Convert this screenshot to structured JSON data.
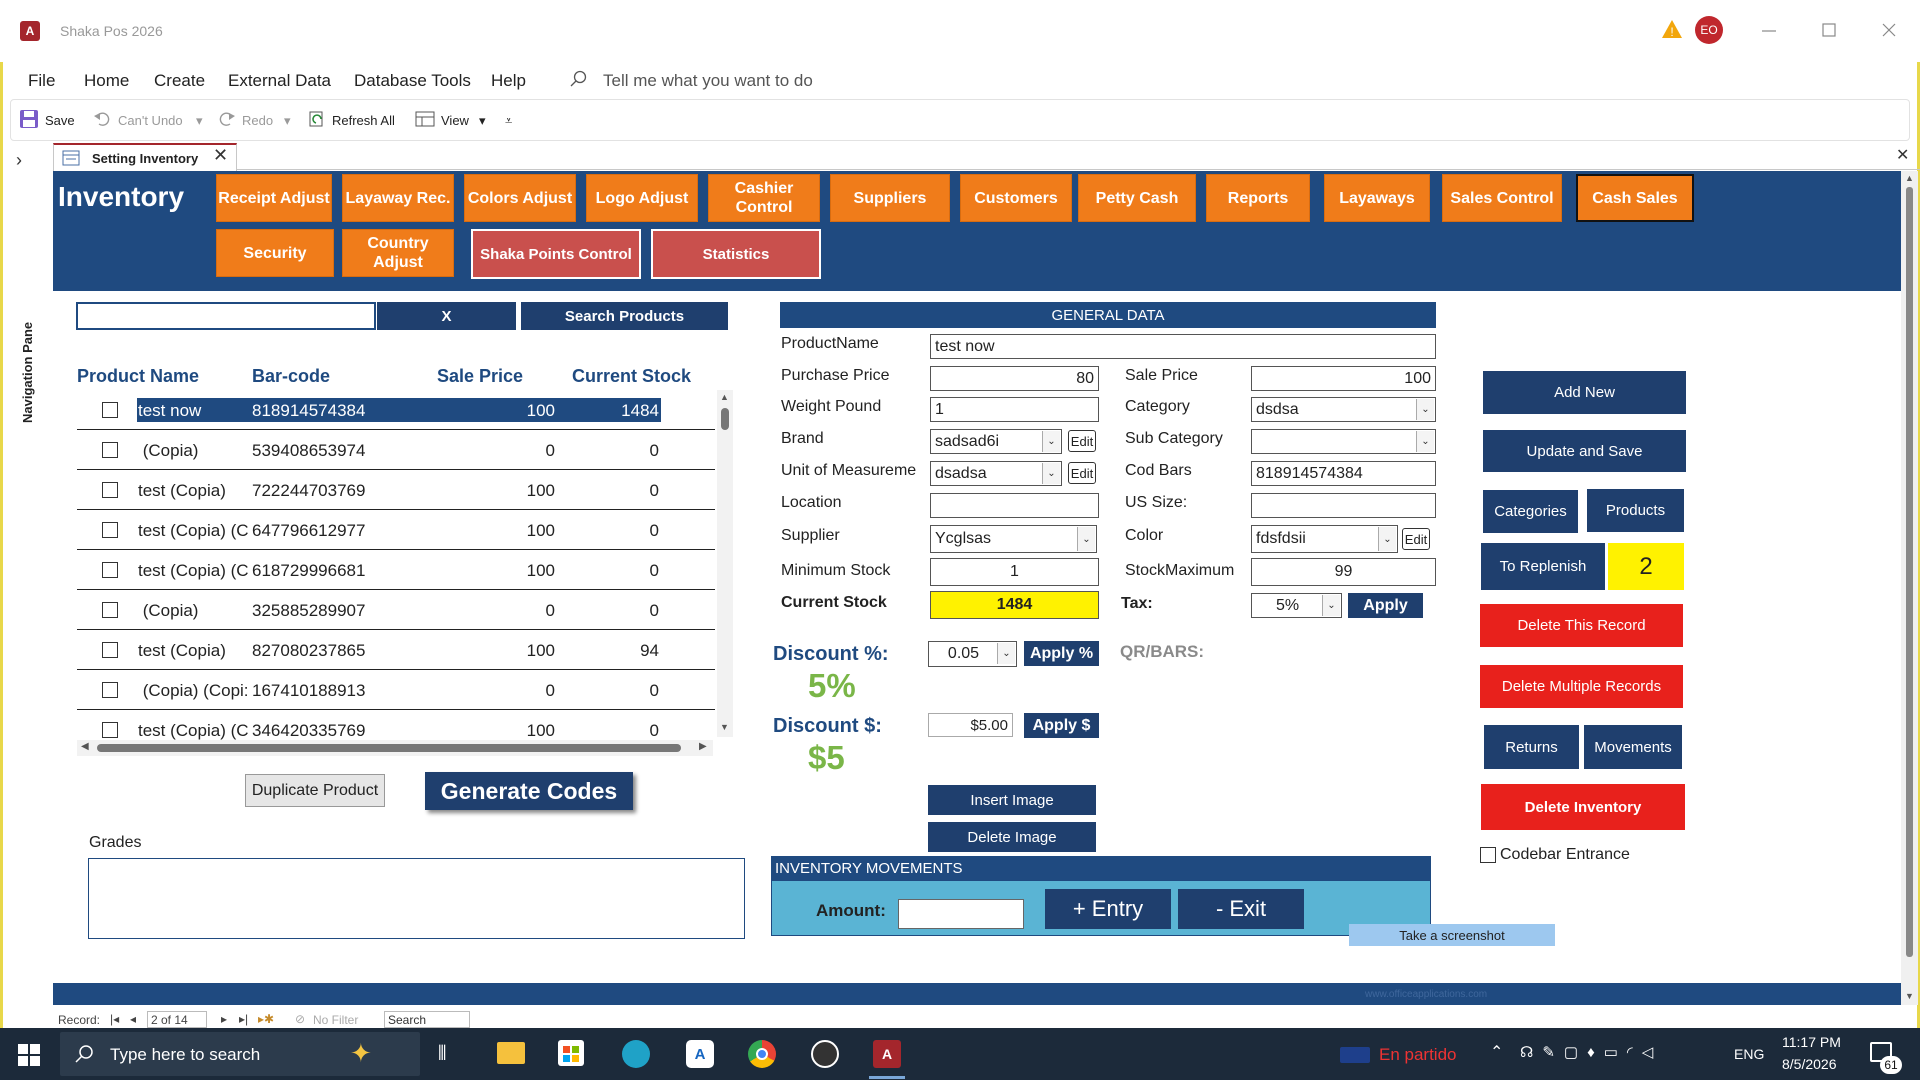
{
  "window": {
    "title": "Shaka Pos 2026",
    "avatar": "EO"
  },
  "menu": {
    "file": "File",
    "home": "Home",
    "create": "Create",
    "external": "External Data",
    "dbtools": "Database Tools",
    "help": "Help",
    "tell": "Tell me what you want to do"
  },
  "qat": {
    "save": "Save",
    "undo": "Can't Undo",
    "redo": "Redo",
    "refresh": "Refresh All",
    "view": "View"
  },
  "nav": {
    "pane": "Navigation Pane"
  },
  "tab": {
    "label": "Setting Inventory"
  },
  "header": {
    "title": "Inventory",
    "row1": [
      "Receipt Adjust",
      "Layaway Rec.",
      "Colors Adjust",
      "Logo Adjust",
      "Cashier Control",
      "Suppliers",
      "Customers",
      "Petty Cash",
      "Reports",
      "Layaways",
      "Sales Control",
      "Cash Sales"
    ],
    "security": "Security",
    "country": "Country Adjust",
    "shaka_points": "Shaka Points Control",
    "statistics": "Statistics"
  },
  "search": {
    "value": "",
    "clear": "X",
    "button": "Search Products"
  },
  "list": {
    "headers": {
      "name": "Product Name",
      "barcode": "Bar-code",
      "price": "Sale Price",
      "stock": "Current Stock"
    },
    "rows": [
      {
        "name": "test now",
        "barcode": "818914574384",
        "price": "100",
        "stock": "1484"
      },
      {
        "name": " (Copia)",
        "barcode": "539408653974",
        "price": "0",
        "stock": "0"
      },
      {
        "name": "test (Copia)",
        "barcode": "722244703769",
        "price": "100",
        "stock": "0"
      },
      {
        "name": "test (Copia) (C",
        "barcode": "647796612977",
        "price": "100",
        "stock": "0"
      },
      {
        "name": "test (Copia) (C",
        "barcode": "618729996681",
        "price": "100",
        "stock": "0"
      },
      {
        "name": " (Copia)",
        "barcode": "325885289907",
        "price": "0",
        "stock": "0"
      },
      {
        "name": "test (Copia)",
        "barcode": "827080237865",
        "price": "100",
        "stock": "94"
      },
      {
        "name": " (Copia) (Copi:",
        "barcode": "167410188913",
        "price": "0",
        "stock": "0"
      },
      {
        "name": "test (Copia) (C",
        "barcode": "346420335769",
        "price": "100",
        "stock": "0"
      }
    ]
  },
  "actions": {
    "duplicate": "Duplicate Product",
    "generate": "Generate Codes",
    "grades": "Grades"
  },
  "general": {
    "title": "GENERAL DATA",
    "product_name_label": "ProductName",
    "product_name": "test now",
    "purchase_label": "Purchase Price",
    "purchase": "80",
    "sale_label": "Sale Price",
    "sale": "100",
    "weight_label": "Weight Pound",
    "weight": "1",
    "category_label": "Category",
    "category": "dsdsa",
    "brand_label": "Brand",
    "brand": "sadsad6i",
    "subcat_label": "Sub Category",
    "subcat": "",
    "unit_label": "Unit of Measureme",
    "unit": "dsadsa",
    "codbars_label": "Cod Bars",
    "codbars": "818914574384",
    "location_label": "Location",
    "location": "",
    "ussize_label": "US Size:",
    "ussize": "",
    "supplier_label": "Supplier",
    "supplier": "Ycglsas",
    "color_label": "Color",
    "color": "fdsfdsii",
    "minstock_label": "Minimum Stock",
    "minstock": "1",
    "maxstock_label": "StockMaximum",
    "maxstock": "99",
    "curstock_label": "Current Stock",
    "curstock": "1484",
    "tax_label": "Tax:",
    "tax": "5%",
    "apply": "Apply",
    "edit": "Edit",
    "disc_pct_label": "Discount %:",
    "disc_pct": "0.05",
    "apply_pct": "Apply %",
    "disc_pct_big": "5%",
    "disc_usd_label": "Discount $:",
    "disc_usd": "$5.00",
    "apply_usd": "Apply $",
    "disc_usd_big": "$5",
    "qr_label": "QR/BARS:",
    "insert_image": "Insert Image",
    "delete_image": "Delete Image"
  },
  "movements": {
    "title": "INVENTORY MOVEMENTS",
    "amount_label": "Amount:",
    "amount": "",
    "entry": "+ Entry",
    "exit": "- Exit",
    "screenshot": "Take a screenshot"
  },
  "right": {
    "add_new": "Add New",
    "update": "Update and Save",
    "categories": "Categories",
    "products": "Products",
    "replenish": "To Replenish",
    "replenish_count": "2",
    "delete_record": "Delete This Record",
    "delete_multiple": "Delete Multiple Records",
    "returns": "Returns",
    "movements": "Movements",
    "delete_inventory": "Delete Inventory",
    "codebar": "Codebar Entrance"
  },
  "footer": {
    "watermark": "www.officeapplications.com"
  },
  "recordnav": {
    "label": "Record:",
    "position": "2 of 14",
    "filter": "No Filter",
    "search": "Search"
  },
  "taskbar": {
    "search": "Type here to search",
    "match": "En partido",
    "lang": "ENG",
    "time": "11:17 PM",
    "date": "8/5/2026",
    "badge": "61"
  }
}
